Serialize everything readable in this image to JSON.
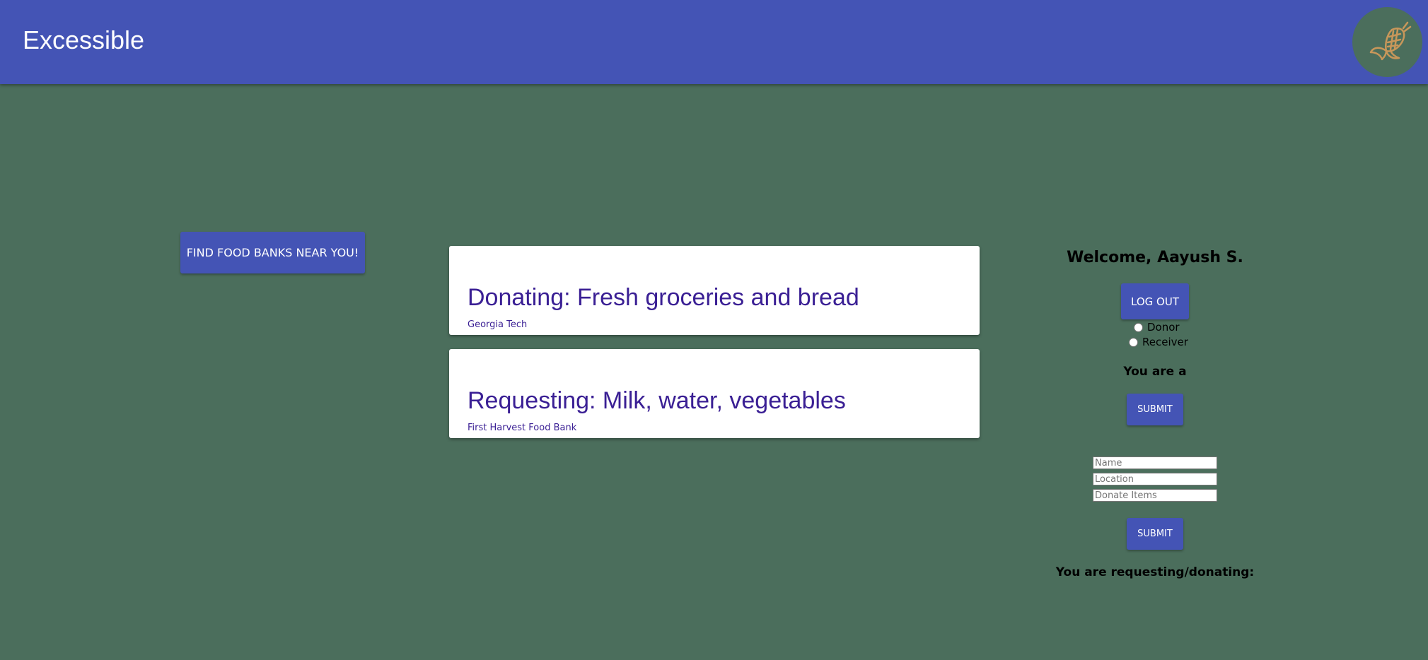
{
  "header": {
    "title": "Excessible",
    "logo_icon": "corn-icon",
    "logo_color": "#c8975a"
  },
  "left": {
    "find_button_label": "FIND FOOD BANKS NEAR YOU!"
  },
  "feed": [
    {
      "title": "Donating: Fresh groceries and bread",
      "location": "Georgia Tech"
    },
    {
      "title": "Requesting: Milk, water, vegetables",
      "location": "First Harvest Food Bank"
    }
  ],
  "account": {
    "welcome": "Welcome, Aayush S.",
    "logout_label": "LOG OUT",
    "roles": [
      "Donor",
      "Receiver"
    ],
    "you_are_label": "You are a",
    "submit_label": "SUBMIT"
  },
  "form": {
    "name_placeholder": "Name",
    "location_placeholder": "Location",
    "items_placeholder": "Donate Items",
    "submit_label": "SUBMIT",
    "status_label": "You are requesting/donating:"
  },
  "colors": {
    "appbar": "#4454b5",
    "background": "#4b6e5c",
    "card_text": "#3a1f94"
  }
}
